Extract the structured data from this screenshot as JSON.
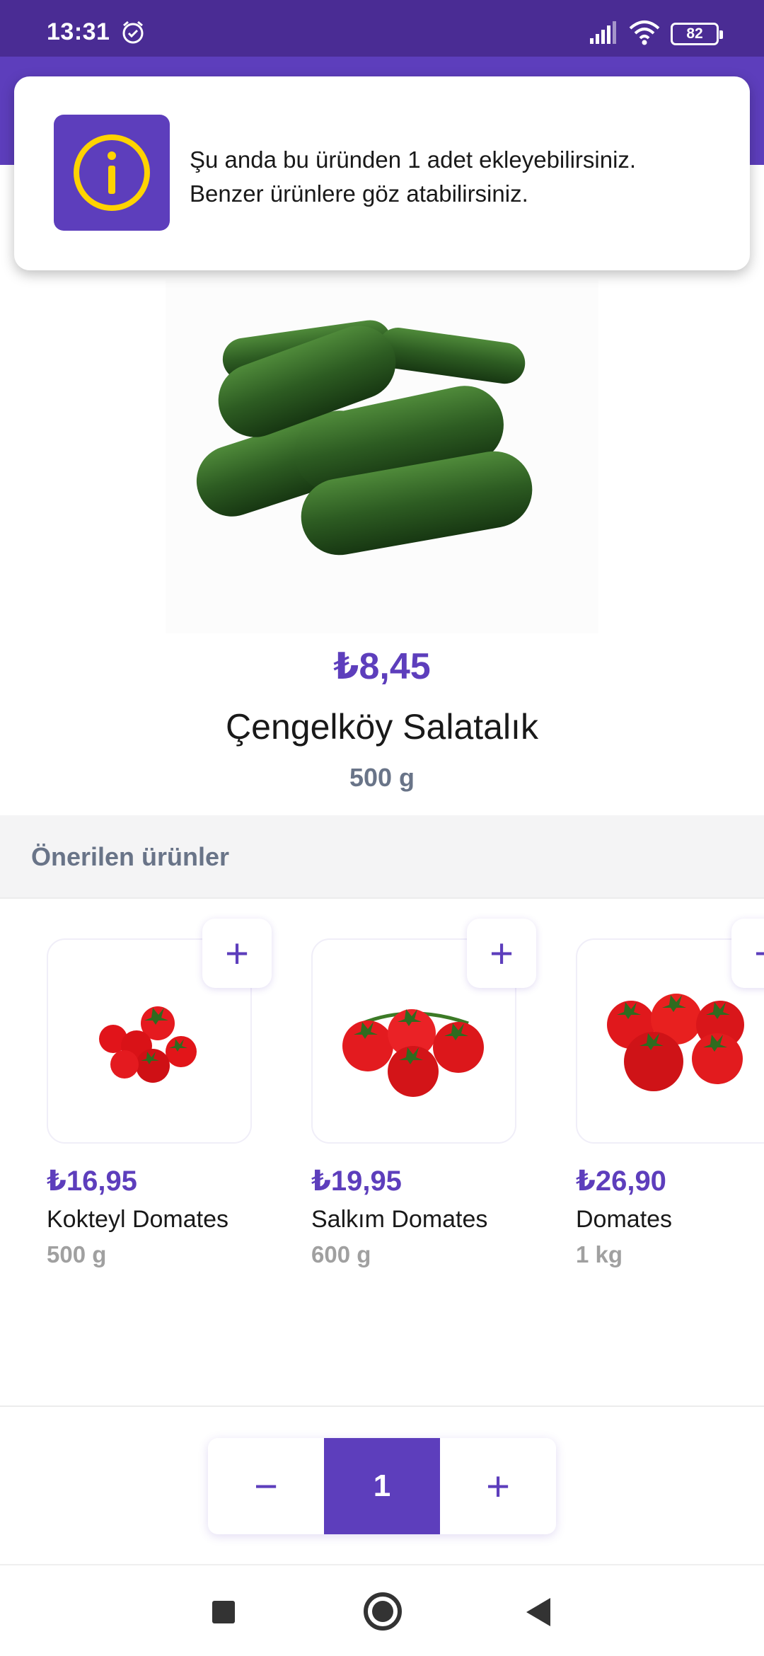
{
  "status_bar": {
    "time": "13:31",
    "battery": "82"
  },
  "toast": {
    "line1": "Şu anda bu üründen 1 adet ekleyebilirsiniz.",
    "line2": "Benzer ürünlere göz atabilirsiniz."
  },
  "product": {
    "price": "₺8,45",
    "name": "Çengelköy Salatalık",
    "weight": "500 g"
  },
  "recommended": {
    "title": "Önerilen ürünler",
    "items": [
      {
        "price": "₺16,95",
        "name": "Kokteyl Domates",
        "weight": "500 g"
      },
      {
        "price": "₺19,95",
        "name": "Salkım Domates",
        "weight": "600 g"
      },
      {
        "price": "₺26,90",
        "name": "Domates",
        "weight": "1 kg"
      }
    ],
    "add_symbol": "+"
  },
  "quantity": {
    "minus": "−",
    "value": "1",
    "plus": "+"
  },
  "colors": {
    "brand": "#5d3ebc",
    "status_bar": "#4a2c94",
    "info_icon": "#ffd300"
  }
}
